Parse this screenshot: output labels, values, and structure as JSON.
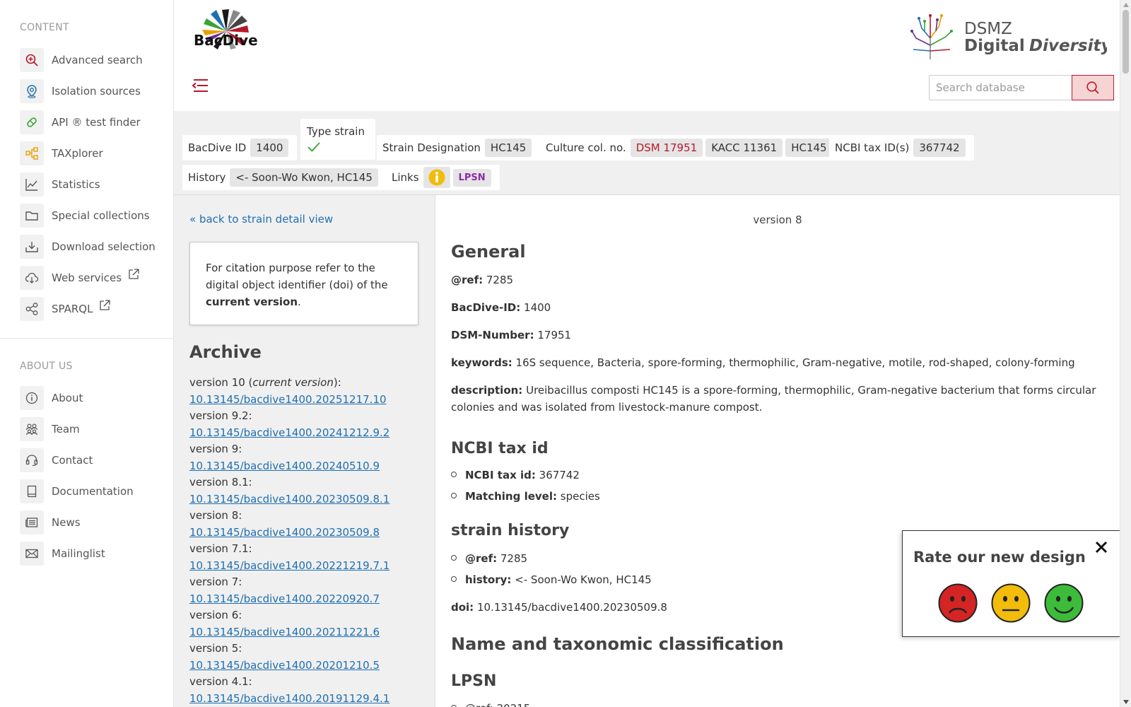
{
  "sidebar": {
    "content_heading": "CONTENT",
    "content_items": [
      {
        "label": "Advanced search",
        "icon": "search-plus-icon",
        "color": "#b7192a"
      },
      {
        "label": "Isolation sources",
        "icon": "location-pin-icon",
        "color": "#1f6fb2"
      },
      {
        "label": "API ® test finder",
        "icon": "pill-icon",
        "color": "#3aa335"
      },
      {
        "label": "TAXplorer",
        "icon": "hierarchy-icon",
        "color": "#e8a000"
      },
      {
        "label": "Statistics",
        "icon": "line-chart-icon",
        "color": "#555555"
      },
      {
        "label": "Special collections",
        "icon": "folder-icon",
        "color": "#555555"
      },
      {
        "label": "Download selection",
        "icon": "download-icon",
        "color": "#555555"
      },
      {
        "label": "Web services",
        "icon": "cloud-download-icon",
        "color": "#555555"
      },
      {
        "label": "SPARQL",
        "icon": "share-nodes-icon",
        "color": "#555555"
      }
    ],
    "about_heading": "ABOUT US",
    "about_items": [
      {
        "label": "About",
        "icon": "info-icon"
      },
      {
        "label": "Team",
        "icon": "team-icon"
      },
      {
        "label": "Contact",
        "icon": "headset-icon"
      },
      {
        "label": "Documentation",
        "icon": "book-icon"
      },
      {
        "label": "News",
        "icon": "newspaper-icon"
      },
      {
        "label": "Mailinglist",
        "icon": "envelope-icon"
      }
    ]
  },
  "header": {
    "bacdive_logo_text": "BacDive",
    "dsmz_logo_line1": "DSMZ",
    "dsmz_logo_line2a": "Digital",
    "dsmz_logo_line2b": "Diversity",
    "search_placeholder": "Search database"
  },
  "infobar": {
    "bacdive_id_label": "BacDive ID",
    "bacdive_id": "1400",
    "type_strain_label": "Type strain",
    "strain_designation_label": "Strain Designation",
    "strain_designation": "HC145",
    "culture_col_label": "Culture col. no.",
    "culture_col": [
      "DSM 17951",
      "KACC 11361",
      "HC145"
    ],
    "ncbi_label": "NCBI tax ID(s)",
    "ncbi_id": "367742",
    "history_label": "History",
    "history": "<- Soon-Wo Kwon, HC145",
    "links_label": "Links",
    "lpsn_label": "LPSN"
  },
  "left": {
    "back_link": "« back to strain detail view",
    "citation_text_1": "For citation purpose refer to the digital object identifier (doi) of the",
    "citation_text_bold": "current version",
    "citation_text_end": ".",
    "archive_title": "Archive",
    "current_version_prefix": "version 10 (",
    "current_version_em": "current version",
    "current_version_suffix": "):",
    "versions": [
      {
        "version": "",
        "doi": "10.13145/bacdive1400.20251217.10"
      },
      {
        "version": "version 9.2:",
        "doi": "10.13145/bacdive1400.20241212.9.2"
      },
      {
        "version": "version 9:",
        "doi": "10.13145/bacdive1400.20240510.9"
      },
      {
        "version": "version 8.1:",
        "doi": "10.13145/bacdive1400.20230509.8.1"
      },
      {
        "version": "version 8:",
        "doi": "10.13145/bacdive1400.20230509.8"
      },
      {
        "version": "version 7.1:",
        "doi": "10.13145/bacdive1400.20221219.7.1"
      },
      {
        "version": "version 7:",
        "doi": "10.13145/bacdive1400.20220920.7"
      },
      {
        "version": "version 6:",
        "doi": "10.13145/bacdive1400.20211221.6"
      },
      {
        "version": "version 5:",
        "doi": "10.13145/bacdive1400.20201210.5"
      },
      {
        "version": "version 4.1:",
        "doi": "10.13145/bacdive1400.20191129.4.1"
      }
    ]
  },
  "main": {
    "version_line": "version 8",
    "general_title": "General",
    "ref_label": "@ref:",
    "ref_value": "7285",
    "bacdive_id_label": "BacDive-ID:",
    "bacdive_id_value": "1400",
    "dsm_label": "DSM-Number:",
    "dsm_value": "17951",
    "keywords_label": "keywords:",
    "keywords_value": "16S sequence, Bacteria, spore-forming, thermophilic, Gram-negative, motile, rod-shaped, colony-forming",
    "description_label": "description:",
    "description_value": "Ureibacillus composti HC145 is a spore-forming, thermophilic, Gram-negative bacterium that forms circular colonies and was isolated from livestock-manure compost.",
    "ncbi_title": "NCBI tax id",
    "ncbi_tax_label": "NCBI tax id:",
    "ncbi_tax_value": "367742",
    "matching_label": "Matching level:",
    "matching_value": "species",
    "history_title": "strain history",
    "hist_ref_label": "@ref:",
    "hist_ref_value": "7285",
    "hist_label": "history:",
    "hist_value": "<- Soon-Wo Kwon, HC145",
    "doi_label": "doi:",
    "doi_value": "10.13145/bacdive1400.20230509.8",
    "taxonomy_title": "Name and taxonomic classification",
    "lpsn_title": "LPSN",
    "lpsn_ref_partial": "@ref: 20215"
  },
  "rating": {
    "title": "Rate our new design",
    "faces": [
      "sad-face-icon",
      "neutral-face-icon",
      "happy-face-icon"
    ]
  },
  "colors": {
    "accent_red": "#b7192a",
    "link_blue": "#1f6fb2",
    "face_red": "#d42424",
    "face_yellow": "#f2bc0b",
    "face_green": "#3dbb3a"
  }
}
